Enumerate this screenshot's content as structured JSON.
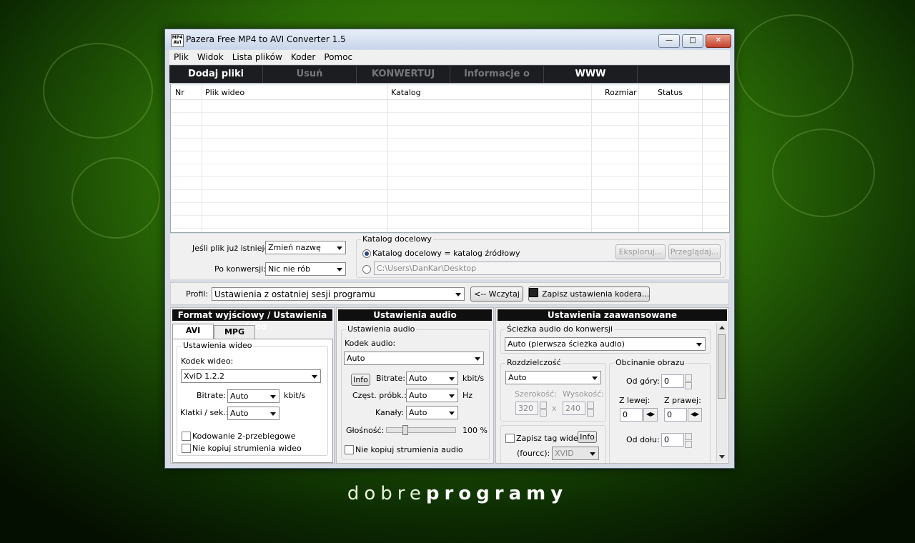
{
  "window": {
    "title": "Pazera Free MP4 to AVI Converter 1.5",
    "icon_text": "MP4 AVI"
  },
  "menu": [
    "Plik",
    "Widok",
    "Lista plików",
    "Koder",
    "Pomoc"
  ],
  "toolbar": [
    {
      "label": "Dodaj pliki",
      "enabled": true
    },
    {
      "label": "Usuń",
      "enabled": false
    },
    {
      "label": "KONWERTUJ",
      "enabled": false
    },
    {
      "label": "Informacje o pliku",
      "enabled": false
    },
    {
      "label": "WWW",
      "enabled": true
    }
  ],
  "file_list": {
    "columns": [
      "Nr",
      "Plik wideo",
      "Katalog",
      "Rozmiar",
      "Status"
    ],
    "rows": []
  },
  "options": {
    "if_exists_label": "Jeśli plik już istnieje:",
    "if_exists_value": "Zmień nazwę",
    "after_label": "Po konwersji:",
    "after_value": "Nic nie rób",
    "target_group": "Katalog docelowy",
    "target_same": "Katalog docelowy = katalog źródłowy",
    "target_path": "C:\\Users\\DanKar\\Desktop",
    "explore_button": "Eksploruj...",
    "browse_button": "Przeglądaj..."
  },
  "profile": {
    "label": "Profil:",
    "value": "Ustawienia z ostatniej sesji programu",
    "load_button": "<-- Wczytaj",
    "save_button": "Zapisz ustawienia kodera..."
  },
  "video_section": {
    "header": "Format wyjściowy / Ustawienia wideo",
    "tabs": [
      "AVI",
      "MPG"
    ],
    "group": "Ustawienia wideo",
    "codec_label": "Kodek wideo:",
    "codec_value": "XviD 1.2.2",
    "bitrate_label": "Bitrate:",
    "bitrate_value": "Auto",
    "bitrate_unit": "kbit/s",
    "fps_label": "Klatki / sek.:",
    "fps_value": "Auto",
    "twopass_label": "Kodowanie 2-przebiegowe",
    "nocopy_label": "Nie kopiuj strumienia wideo"
  },
  "audio_section": {
    "header": "Ustawienia audio",
    "group": "Ustawienia audio",
    "codec_label": "Kodek audio:",
    "codec_value": "Auto",
    "info_button": "Info",
    "bitrate_label": "Bitrate:",
    "bitrate_value": "Auto",
    "bitrate_unit": "kbit/s",
    "rate_label": "Częst. próbk.:",
    "rate_value": "Auto",
    "rate_unit": "Hz",
    "channels_label": "Kanały:",
    "channels_value": "Auto",
    "volume_label": "Głośność:",
    "volume_value": "100 %",
    "volume_level": 0.25,
    "nocopy_label": "Nie kopiuj strumienia audio"
  },
  "advanced_section": {
    "header": "Ustawienia zaawansowane",
    "track_label": "Ścieżka audio do konwersji",
    "track_value": "Auto (pierwsza ścieżka audio)",
    "resolution_group": "Rozdzielczość",
    "resolution_value": "Auto",
    "width_label": "Szerokość:",
    "height_label": "Wysokość:",
    "width_value": "320",
    "height_value": "240",
    "x_sep": "x",
    "crop_group": "Obcinanie obrazu",
    "top_label": "Od góry:",
    "top_value": "0",
    "left_label": "Z lewej:",
    "left_value": "0",
    "right_label": "Z prawej:",
    "right_value": "0",
    "bottom_label": "Od dołu:",
    "bottom_value": "0",
    "tag_label": "Zapisz tag wideo",
    "tag_info": "Info",
    "fourcc_label": "(fourcc):",
    "fourcc_value": "XVID"
  },
  "brand": {
    "light": "dobre",
    "bold": "programy"
  }
}
